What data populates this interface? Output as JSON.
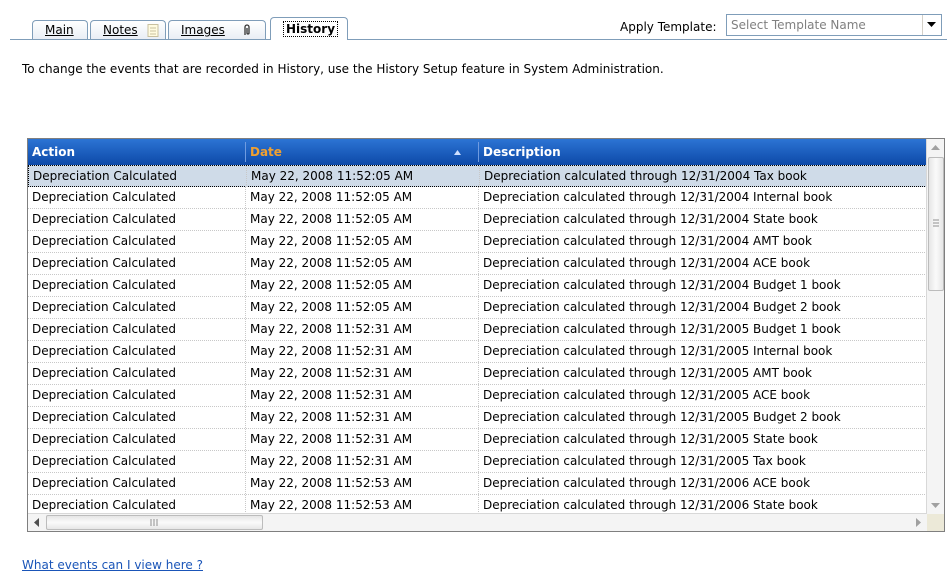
{
  "tabs": [
    {
      "label": "Main",
      "icon": null
    },
    {
      "label": "Notes",
      "icon": "note-icon"
    },
    {
      "label": "Images",
      "icon": "paperclip-icon"
    },
    {
      "label": "History",
      "icon": null,
      "active": true
    }
  ],
  "template": {
    "label": "Apply Template:",
    "placeholder": "Select Template Name"
  },
  "info_text": "To change the events that are recorded in History, use the History Setup feature in System Administration.",
  "grid": {
    "columns": [
      "Action",
      "Date",
      "Description"
    ],
    "sorted_column": "Date",
    "sort_direction": "ascending",
    "rows": [
      {
        "action": "Depreciation Calculated",
        "date": "May 22, 2008   11:52:05 AM",
        "description": "Depreciation calculated through 12/31/2004 Tax book"
      },
      {
        "action": "Depreciation Calculated",
        "date": "May 22, 2008   11:52:05 AM",
        "description": "Depreciation calculated through 12/31/2004 Internal book"
      },
      {
        "action": "Depreciation Calculated",
        "date": "May 22, 2008   11:52:05 AM",
        "description": "Depreciation calculated through 12/31/2004 State book"
      },
      {
        "action": "Depreciation Calculated",
        "date": "May 22, 2008   11:52:05 AM",
        "description": "Depreciation calculated through 12/31/2004 AMT book"
      },
      {
        "action": "Depreciation Calculated",
        "date": "May 22, 2008   11:52:05 AM",
        "description": "Depreciation calculated through 12/31/2004 ACE book"
      },
      {
        "action": "Depreciation Calculated",
        "date": "May 22, 2008   11:52:05 AM",
        "description": "Depreciation calculated through 12/31/2004 Budget 1 book"
      },
      {
        "action": "Depreciation Calculated",
        "date": "May 22, 2008   11:52:05 AM",
        "description": "Depreciation calculated through 12/31/2004 Budget 2 book"
      },
      {
        "action": "Depreciation Calculated",
        "date": "May 22, 2008   11:52:31 AM",
        "description": "Depreciation calculated through 12/31/2005 Budget 1 book"
      },
      {
        "action": "Depreciation Calculated",
        "date": "May 22, 2008   11:52:31 AM",
        "description": "Depreciation calculated through 12/31/2005 Internal book"
      },
      {
        "action": "Depreciation Calculated",
        "date": "May 22, 2008   11:52:31 AM",
        "description": "Depreciation calculated through 12/31/2005 AMT book"
      },
      {
        "action": "Depreciation Calculated",
        "date": "May 22, 2008   11:52:31 AM",
        "description": "Depreciation calculated through 12/31/2005 ACE book"
      },
      {
        "action": "Depreciation Calculated",
        "date": "May 22, 2008   11:52:31 AM",
        "description": "Depreciation calculated through 12/31/2005 Budget 2 book"
      },
      {
        "action": "Depreciation Calculated",
        "date": "May 22, 2008   11:52:31 AM",
        "description": "Depreciation calculated through 12/31/2005 State book"
      },
      {
        "action": "Depreciation Calculated",
        "date": "May 22, 2008   11:52:31 AM",
        "description": "Depreciation calculated through 12/31/2005 Tax book"
      },
      {
        "action": "Depreciation Calculated",
        "date": "May 22, 2008   11:52:53 AM",
        "description": "Depreciation calculated through 12/31/2006 ACE book"
      },
      {
        "action": "Depreciation Calculated",
        "date": "May 22, 2008   11:52:53 AM",
        "description": "Depreciation calculated through 12/31/2006 State book"
      }
    ],
    "selected_row": 0
  },
  "help_link": "What events can I view here ?",
  "colors": {
    "header_bg": "#1558c0",
    "sorted_header_text": "#f0a030",
    "selected_row_bg": "#cfdbe8",
    "link": "#1a55b8"
  }
}
